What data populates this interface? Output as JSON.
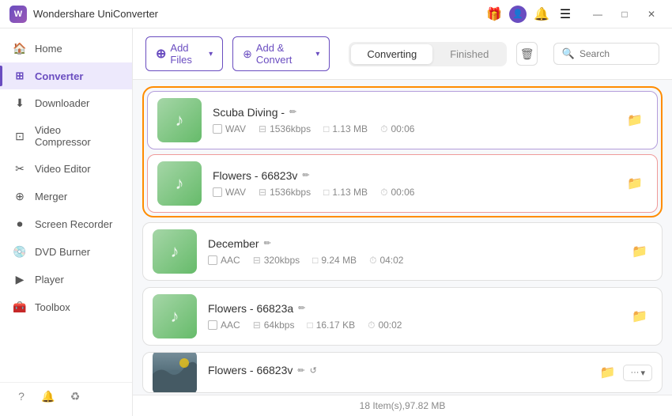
{
  "titlebar": {
    "app_name": "Wondershare UniConverter",
    "icons": [
      "gift",
      "user",
      "bell",
      "menu"
    ],
    "win_controls": [
      "—",
      "□",
      "✕"
    ]
  },
  "sidebar": {
    "items": [
      {
        "id": "home",
        "label": "Home",
        "icon": "🏠",
        "active": false
      },
      {
        "id": "converter",
        "label": "Converter",
        "icon": "⊞",
        "active": true
      },
      {
        "id": "downloader",
        "label": "Downloader",
        "icon": "⬇",
        "active": false
      },
      {
        "id": "video-compressor",
        "label": "Video Compressor",
        "icon": "⊡",
        "active": false
      },
      {
        "id": "video-editor",
        "label": "Video Editor",
        "icon": "✂",
        "active": false
      },
      {
        "id": "merger",
        "label": "Merger",
        "icon": "⊕",
        "active": false
      },
      {
        "id": "screen-recorder",
        "label": "Screen Recorder",
        "icon": "⏺",
        "active": false
      },
      {
        "id": "dvd-burner",
        "label": "DVD Burner",
        "icon": "💿",
        "active": false
      },
      {
        "id": "player",
        "label": "Player",
        "icon": "▶",
        "active": false
      },
      {
        "id": "toolbox",
        "label": "Toolbox",
        "icon": "🧰",
        "active": false
      }
    ]
  },
  "toolbar": {
    "add_files_label": "Add Files",
    "add_files_dropdown": true,
    "add_convert_label": "Add & Convert",
    "add_convert_dropdown": true
  },
  "tabs": {
    "converting_label": "Converting",
    "finished_label": "Finished",
    "active": "converting"
  },
  "search": {
    "placeholder": "Search"
  },
  "files": [
    {
      "id": "scuba-diving",
      "name": "Scuba Diving -",
      "format": "WAV",
      "bitrate": "1536kbps",
      "size": "1.13 MB",
      "duration": "00:06",
      "group": "converting",
      "thumb_type": "music"
    },
    {
      "id": "flowers-66823v",
      "name": "Flowers - 66823v",
      "format": "WAV",
      "bitrate": "1536kbps",
      "size": "1.13 MB",
      "duration": "00:06",
      "group": "converting",
      "thumb_type": "music"
    },
    {
      "id": "december",
      "name": "December",
      "format": "AAC",
      "bitrate": "320kbps",
      "size": "9.24 MB",
      "duration": "04:02",
      "group": "normal",
      "thumb_type": "music"
    },
    {
      "id": "flowers-66823a",
      "name": "Flowers - 66823a",
      "format": "AAC",
      "bitrate": "64kbps",
      "size": "16.17 KB",
      "duration": "00:02",
      "group": "normal",
      "thumb_type": "music"
    },
    {
      "id": "flowers-66823v2",
      "name": "Flowers - 66823v",
      "format": "",
      "bitrate": "",
      "size": "",
      "duration": "",
      "group": "normal",
      "thumb_type": "photo"
    }
  ],
  "statusbar": {
    "text": "18 Item(s),97.82 MB"
  },
  "bottom_nav": {
    "icons": [
      "?",
      "🔔",
      "♻"
    ]
  }
}
